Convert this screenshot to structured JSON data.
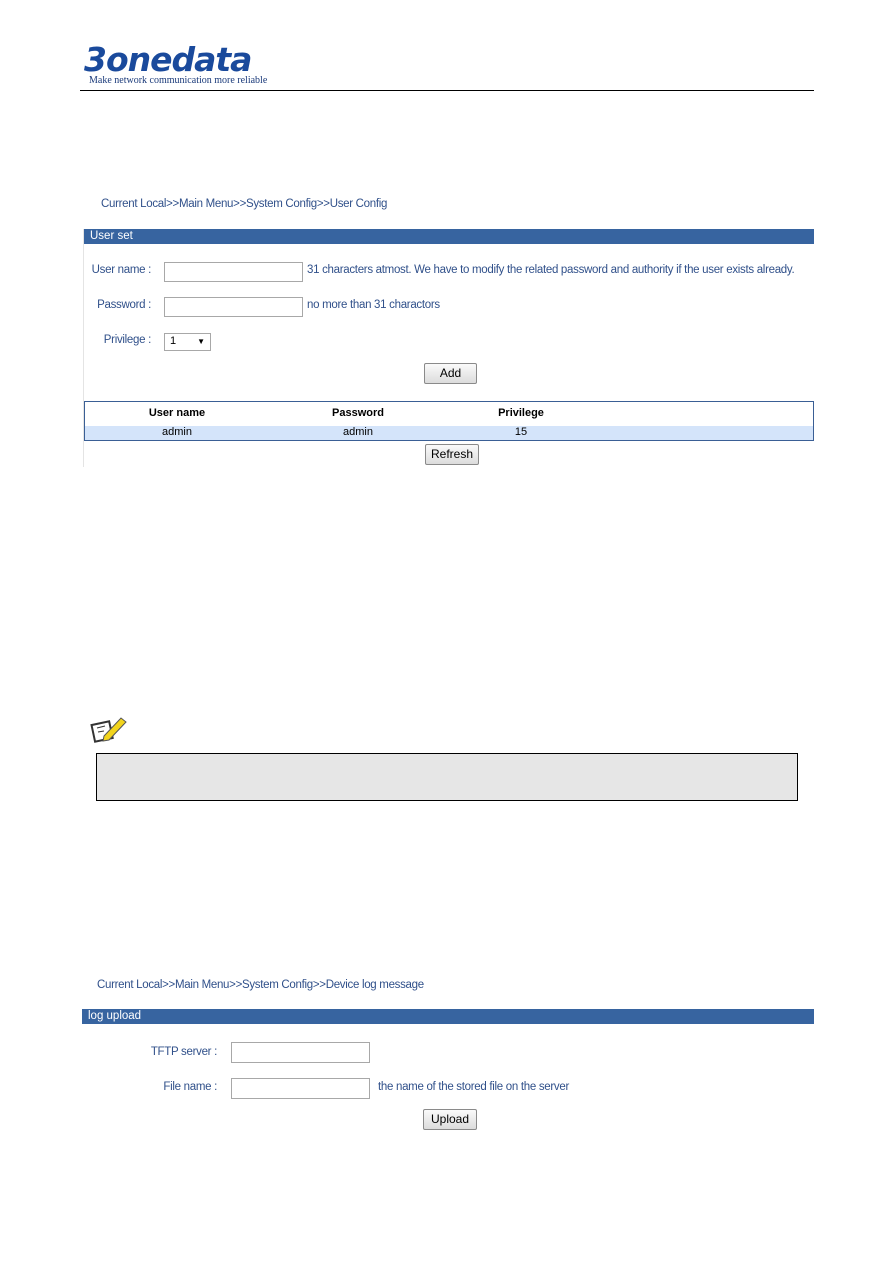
{
  "header": {
    "logo": "3onedata",
    "tagline": "Make network communication more reliable"
  },
  "user_config": {
    "breadcrumb": "Current Local>>Main Menu>>System Config>>User Config",
    "section_title": "User set",
    "username_label": "User name :",
    "username_value": "",
    "username_hint": "31 characters atmost. We have to modify the related password and authority if the user exists already.",
    "password_label": "Password :",
    "password_value": "",
    "password_hint": "no more than 31 charactors",
    "privilege_label": "Privilege :",
    "privilege_value": "1",
    "add_button": "Add",
    "table": {
      "headers": [
        "User name",
        "Password",
        "Privilege"
      ],
      "rows": [
        [
          "admin",
          "admin",
          "15"
        ]
      ]
    },
    "refresh_button": "Refresh"
  },
  "note": {
    "icon": "note-pencil-icon",
    "text": ""
  },
  "log_upload": {
    "breadcrumb": "Current Local>>Main Menu>>System Config>>Device log message",
    "section_title": "log upload",
    "tftp_label": "TFTP server :",
    "tftp_value": "",
    "filename_label": "File name :",
    "filename_value": "",
    "filename_hint": "the name of the stored file on the server",
    "upload_button": "Upload"
  },
  "colors": {
    "brand": "#1a4a9c",
    "section_bar": "#3764a0",
    "row_highlight": "#d4e4fa",
    "text": "#30508a"
  }
}
